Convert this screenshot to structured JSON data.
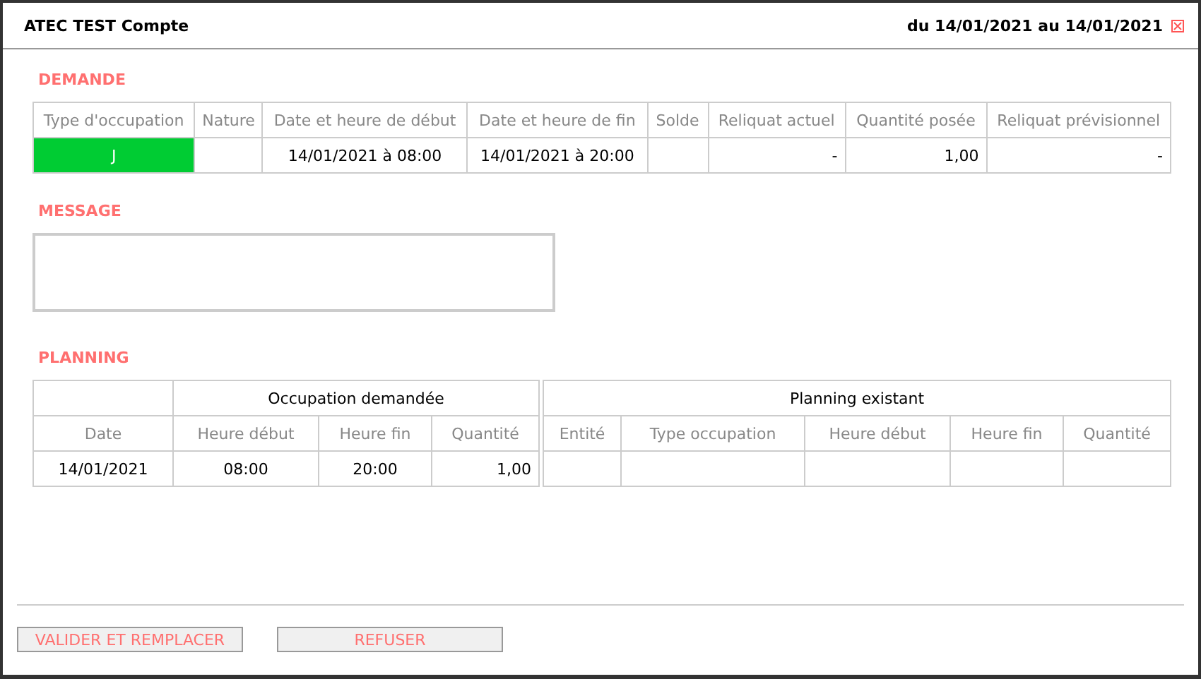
{
  "window": {
    "title": "ATEC TEST Compte",
    "period": "du 14/01/2021 au 14/01/2021"
  },
  "demande": {
    "heading": "DEMANDE",
    "columns": [
      "Type d'occupation",
      "Nature",
      "Date et heure de début",
      "Date et heure de fin",
      "Solde",
      "Reliquat actuel",
      "Quantité posée",
      "Reliquat prévisionnel"
    ],
    "rows": [
      {
        "type": {
          "text": "J",
          "color": "#00cc33"
        },
        "date_debut": "14/01/2021 à 08:00",
        "date_fin": "14/01/2021 à 20:00",
        "reliquat_actuel": "-",
        "quantite_posee": "1,00",
        "reliquat_previsionnel": "-"
      }
    ]
  },
  "message": {
    "heading": "MESSAGE"
  },
  "planning": {
    "heading": "PLANNING",
    "requested": {
      "title": "Occupation demandée",
      "columns": [
        "Date",
        "Heure début",
        "Heure fin",
        "Quantité"
      ],
      "rows": [
        {
          "date": "14/01/2021",
          "heure_debut": "08:00",
          "heure_fin": "20:00",
          "quantite": "1,00"
        }
      ]
    },
    "existing": {
      "title": "Planning existant",
      "columns": [
        "Entité",
        "Type occupation",
        "Heure début",
        "Heure fin",
        "Quantité"
      ]
    }
  },
  "buttons": [
    {
      "label": "VALIDER ET REMPLACER"
    },
    {
      "label": "REFUSER"
    }
  ]
}
